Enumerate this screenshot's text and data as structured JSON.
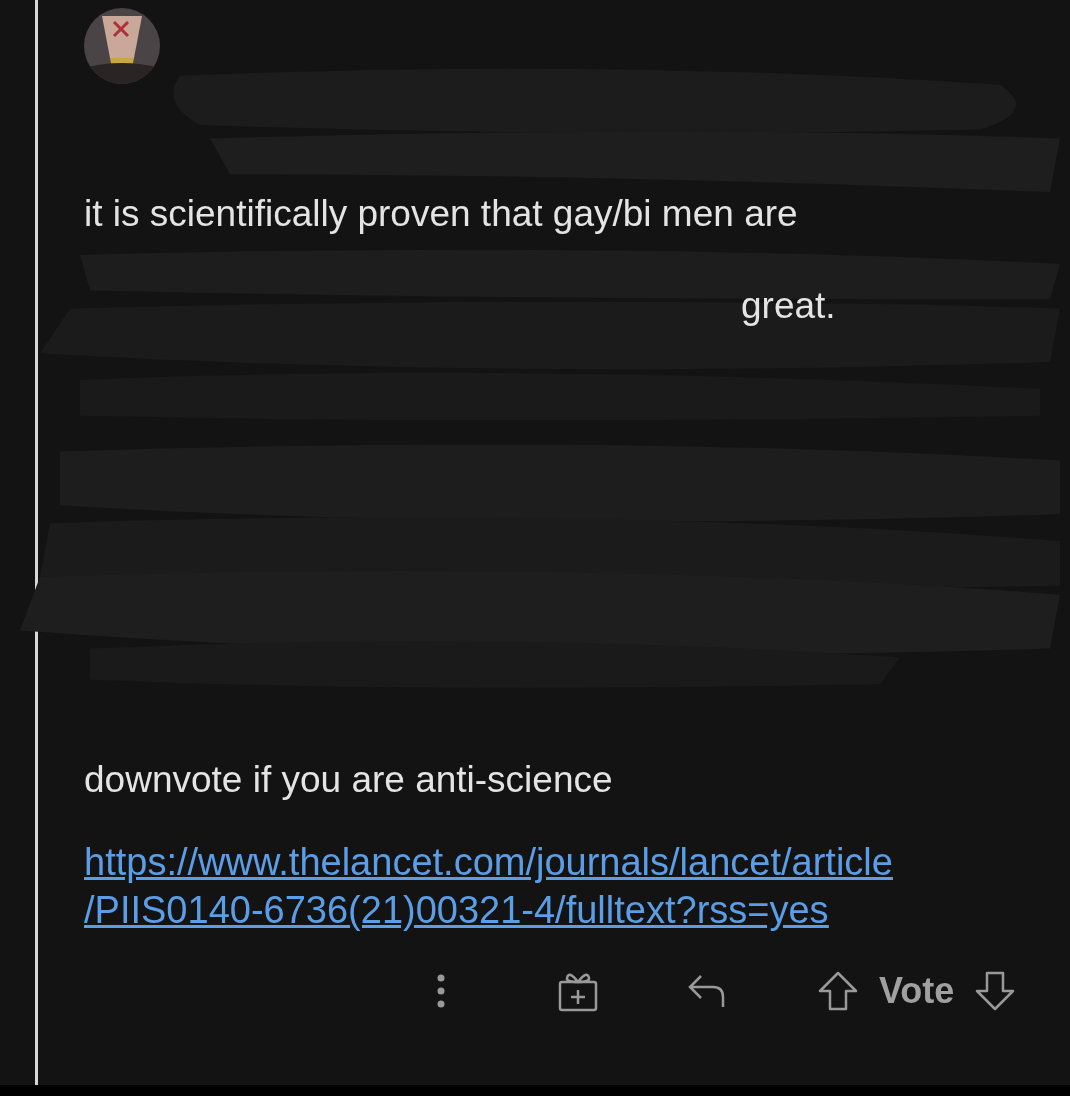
{
  "comment": {
    "body": {
      "first_line": "it is scientifically proven that gay/bi men are",
      "fragment": "great.",
      "closing": "downvote if you are anti-science",
      "link_lines": [
        "https://www.thelancet.com/journals/lancet/article",
        "/PIIS0140-6736(21)00321-4/fulltext?rss=yes"
      ]
    },
    "actions": [
      {
        "kind": "more"
      },
      {
        "kind": "award"
      },
      {
        "kind": "reply"
      },
      {
        "kind": "vote",
        "label": "Vote"
      }
    ]
  }
}
